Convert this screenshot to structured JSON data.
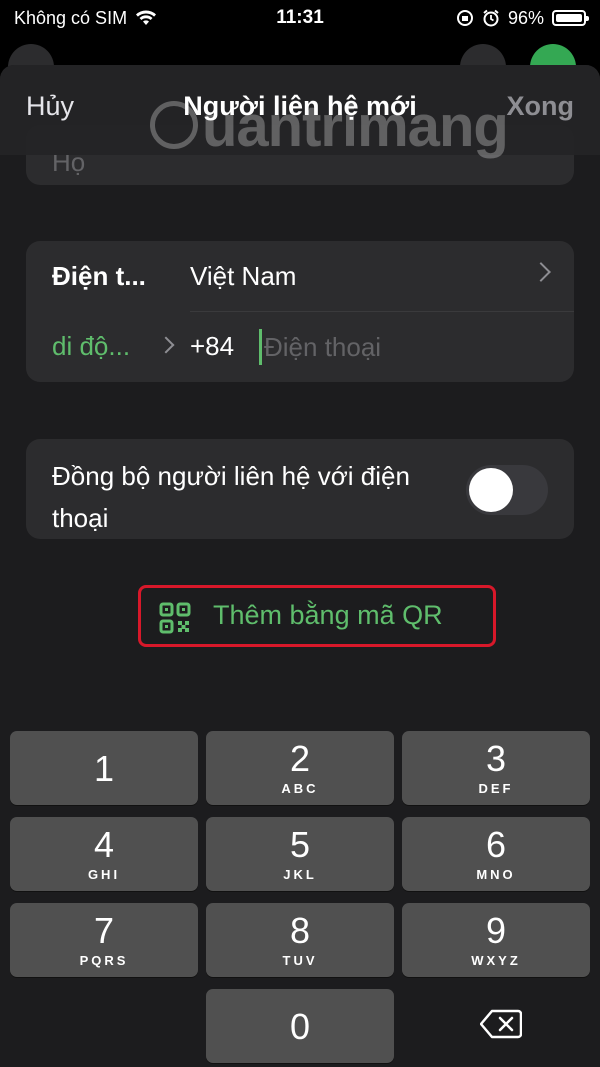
{
  "status_bar": {
    "carrier": "Không có SIM",
    "time": "11:31",
    "battery": "96%"
  },
  "nav": {
    "cancel": "Hủy",
    "title": "Người liên hệ mới",
    "done": "Xong"
  },
  "watermark": "uantrimang",
  "form": {
    "last_name_placeholder": "Họ",
    "phone_label": "Điện t...",
    "country": "Việt Nam",
    "phone_type": "di độ...",
    "country_code": "+84",
    "phone_placeholder": "Điện thoại",
    "sync_label": "Đồng bộ người liên hệ với điện thoại",
    "sync_enabled": false,
    "qr_button": "Thêm bằng mã QR"
  },
  "keypad": {
    "keys": [
      {
        "digit": "1",
        "letters": ""
      },
      {
        "digit": "2",
        "letters": "ABC"
      },
      {
        "digit": "3",
        "letters": "DEF"
      },
      {
        "digit": "4",
        "letters": "GHI"
      },
      {
        "digit": "5",
        "letters": "JKL"
      },
      {
        "digit": "6",
        "letters": "MNO"
      },
      {
        "digit": "7",
        "letters": "PQRS"
      },
      {
        "digit": "8",
        "letters": "TUV"
      },
      {
        "digit": "9",
        "letters": "WXYZ"
      },
      {
        "digit": "0",
        "letters": ""
      }
    ]
  },
  "colors": {
    "accent_green": "#5fbd6c",
    "highlight_red": "#d7182a"
  }
}
